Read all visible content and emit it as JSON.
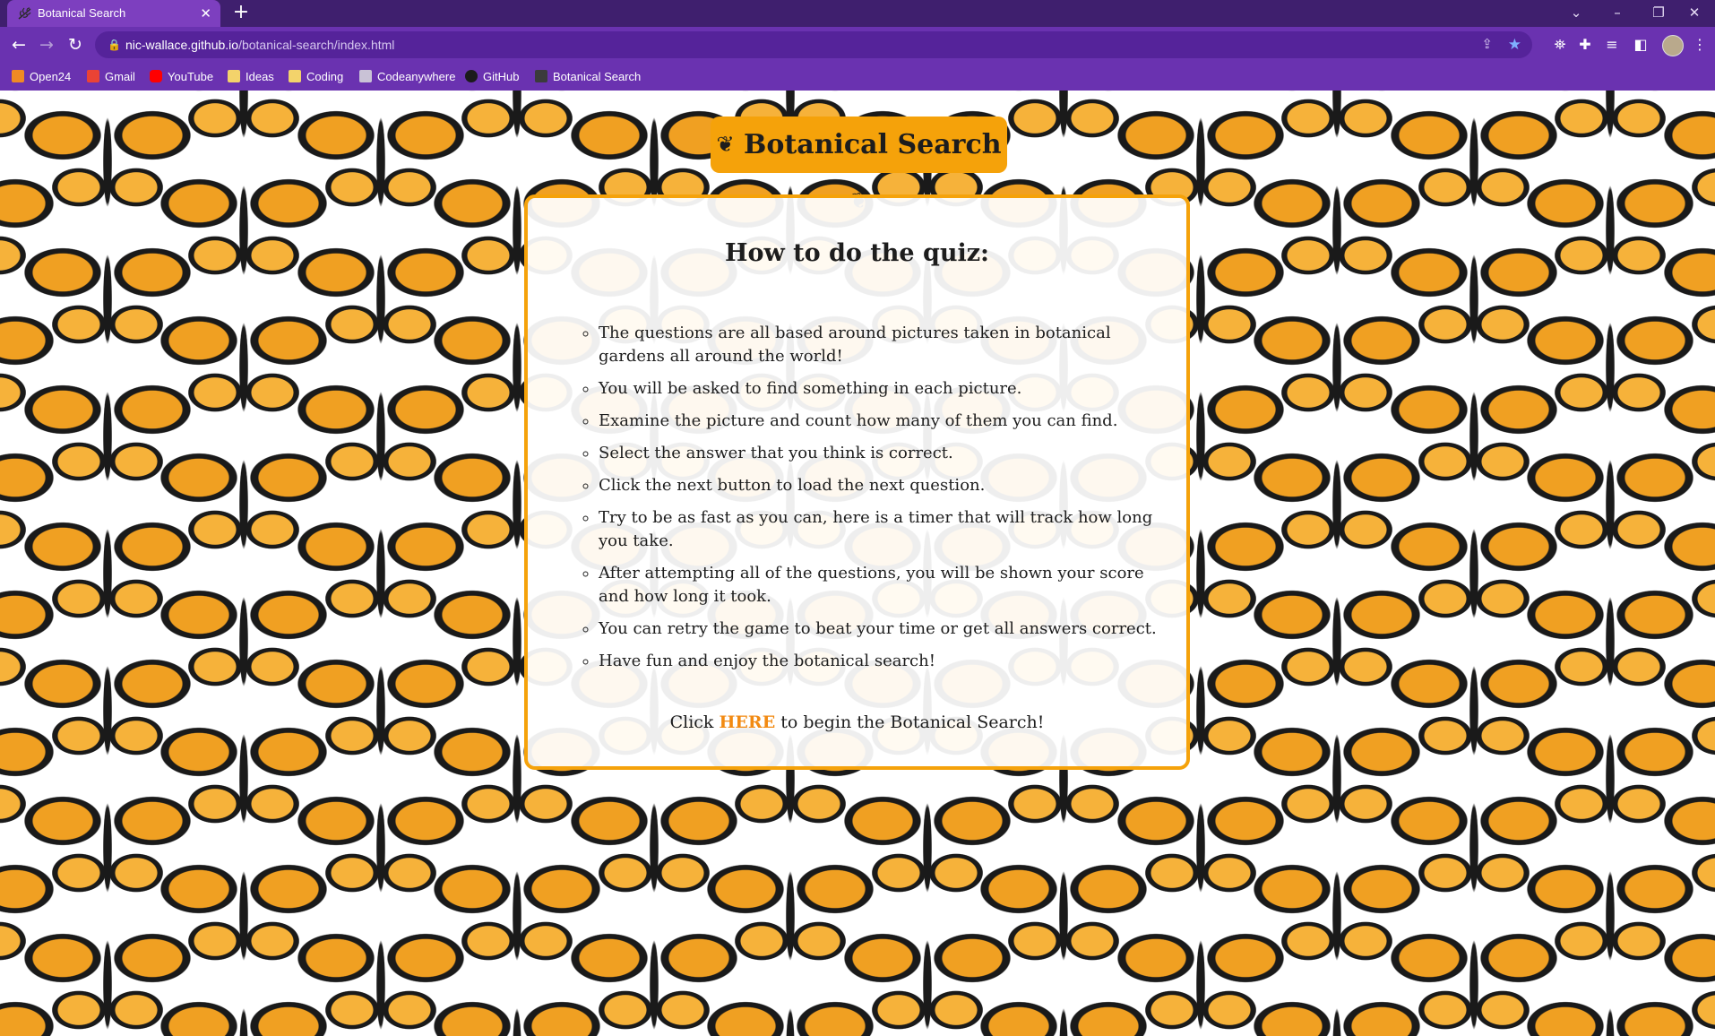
{
  "browser": {
    "tab_title": "Botanical Search",
    "tab_close": "✕",
    "new_tab": "+",
    "url_host": "nic-wallace.github.io",
    "url_path": "/botanical-search/index.html",
    "bookmarks": [
      "Open24",
      "Gmail",
      "YouTube",
      "Ideas",
      "Coding",
      "Codeanywhere",
      "GitHub",
      "Botanical Search"
    ]
  },
  "page": {
    "title": "Botanical Search",
    "card_heading": "How to do the quiz:",
    "instructions": [
      "The questions are all based around pictures taken in botanical gardens all around the world!",
      "You will be asked to find something in each picture.",
      "Examine the picture and count how many of them you can find.",
      "Select the answer that you think is correct.",
      "Click the next button to load the next question.",
      "Try to be as fast as you can, here is a timer that will track how long you take.",
      "After attempting all of the questions, you will be shown your score and how long it took.",
      "You can retry the game to beat your time or get all answers correct.",
      "Have fun and enjoy the botanical search!"
    ],
    "cta_before": "Click ",
    "cta_link": "HERE",
    "cta_after": " to begin the Botanical Search!"
  },
  "colors": {
    "tabbar": "#3f1f6e",
    "toolbar": "#6a32b0",
    "accent_orange": "#f5a20a",
    "link_orange": "#f28a12"
  }
}
